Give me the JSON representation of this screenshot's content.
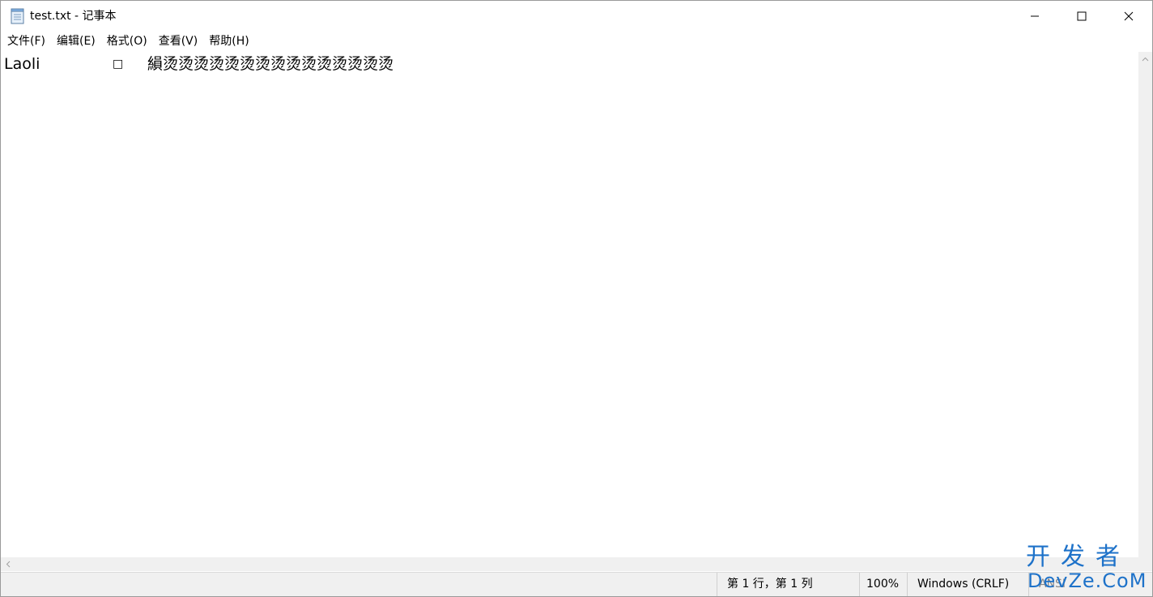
{
  "window": {
    "title": "test.txt - 记事本"
  },
  "menu": {
    "items": [
      "文件(F)",
      "编辑(E)",
      "格式(O)",
      "查看(V)",
      "帮助(H)"
    ]
  },
  "editor": {
    "segment1": "Laoli",
    "segment2": "□",
    "segment3": "縜烫烫烫烫烫烫烫烫烫烫烫烫烫烫烫"
  },
  "statusbar": {
    "position": "第 1 行，第 1 列",
    "zoom": "100%",
    "line_ending": "Windows (CRLF)",
    "encoding": "ANSI"
  },
  "watermark": {
    "cn": "开发者",
    "en": "DevZe.CoM"
  },
  "icons": {
    "app": "notepad-icon",
    "minimize": "minimize-icon",
    "maximize": "maximize-icon",
    "close": "close-icon"
  },
  "colors": {
    "watermark": "#1e72c9",
    "statusbar_bg": "#f0f0f0"
  }
}
